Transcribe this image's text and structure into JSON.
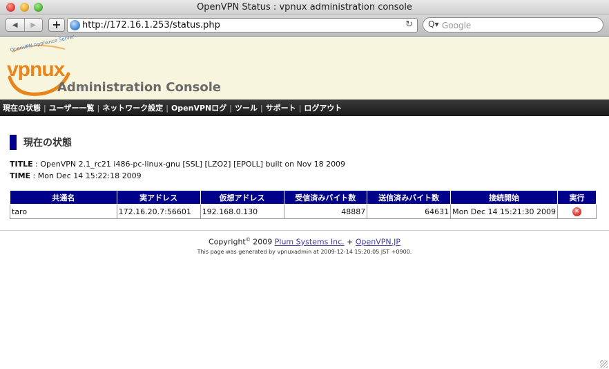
{
  "window": {
    "title": "OpenVPN Status : vpnux administration console"
  },
  "browser": {
    "back_icon": "◀",
    "forward_icon": "▶",
    "add_icon": "+",
    "url": "http://172.16.1.253/status.php",
    "reload_icon": "↻",
    "search_icon": "Q▾",
    "search_placeholder": "Google"
  },
  "header": {
    "logo_text": "vpnux",
    "logo_tagline": "OpenVPN Appliance Server",
    "console_title": "Administration Console"
  },
  "menu": {
    "items": [
      "現在の状態",
      "ユーザー一覧",
      "ネットワーク設定",
      "OpenVPNログ",
      "ツール",
      "サポート",
      "ログアウト"
    ],
    "separator": "|"
  },
  "page": {
    "heading": "現在の状態",
    "title_label": "TITLE",
    "title_value": " : OpenVPN 2.1_rc21 i486-pc-linux-gnu [SSL] [LZO2] [EPOLL] built on Nov 18 2009",
    "time_label": "TIME",
    "time_value": " : Mon Dec 14 15:22:18 2009"
  },
  "table": {
    "headers": [
      "共通名",
      "実アドレス",
      "仮想アドレス",
      "受信済みバイト数",
      "送信済みバイト数",
      "接続開始",
      "実行"
    ],
    "rows": [
      {
        "common_name": "taro",
        "real_address": "172.16.20.7:56601",
        "virtual_address": "192.168.0.130",
        "bytes_received": "48887",
        "bytes_sent": "64631",
        "connected_since": "Mon Dec 14 15:21:30 2009",
        "action_icon": "delete-icon"
      }
    ]
  },
  "footer": {
    "copyright_prefix": "Copyright",
    "copyright_symbol": "©",
    "year": " 2009 ",
    "link1": "Plum Systems Inc.",
    "plus": " + ",
    "link2": "OpenVPN.JP",
    "generated": "This page was generated by vpnuxadmin at 2009-12-14 15:20:05 JST +0900."
  },
  "colors": {
    "accent": "#00008b",
    "header_bg": "#f7f5dd",
    "logo_orange": "#e8851c",
    "menubar": "#222222"
  }
}
